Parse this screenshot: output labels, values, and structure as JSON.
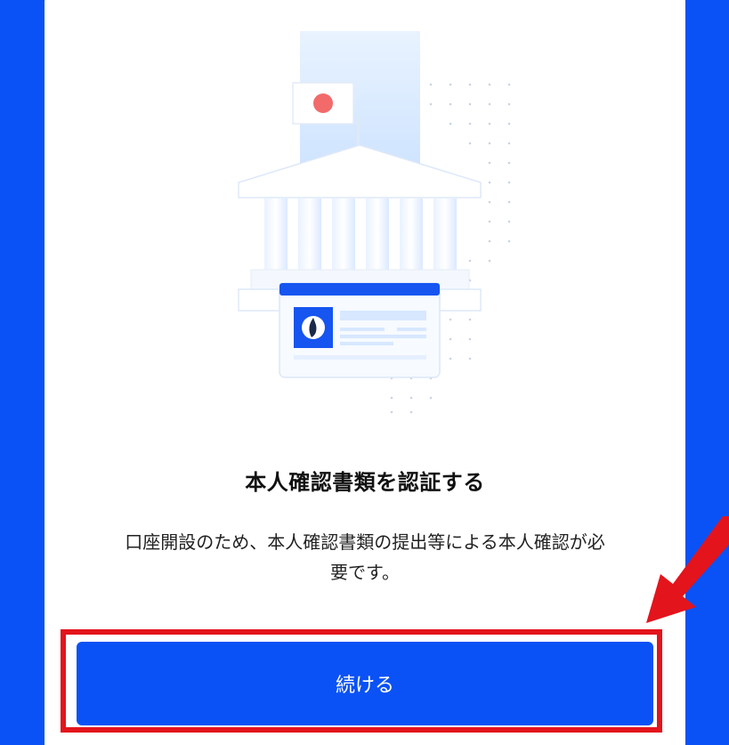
{
  "card": {
    "title": "本人確認書類を認証する",
    "description_line1": "口座開設のため、本人確認書類の提出等による本人確認が必",
    "description_line2": "要です。",
    "continue_label": "続ける"
  },
  "illustration": {
    "icon": "bank-with-id-card-icon",
    "flag_icon": "japan-flag-icon"
  },
  "annotation": {
    "arrow_icon": "red-arrow-icon",
    "frame_color": "#e3141c"
  },
  "colors": {
    "brand_blue": "#0a52f5",
    "annotation_red": "#e3141c"
  }
}
